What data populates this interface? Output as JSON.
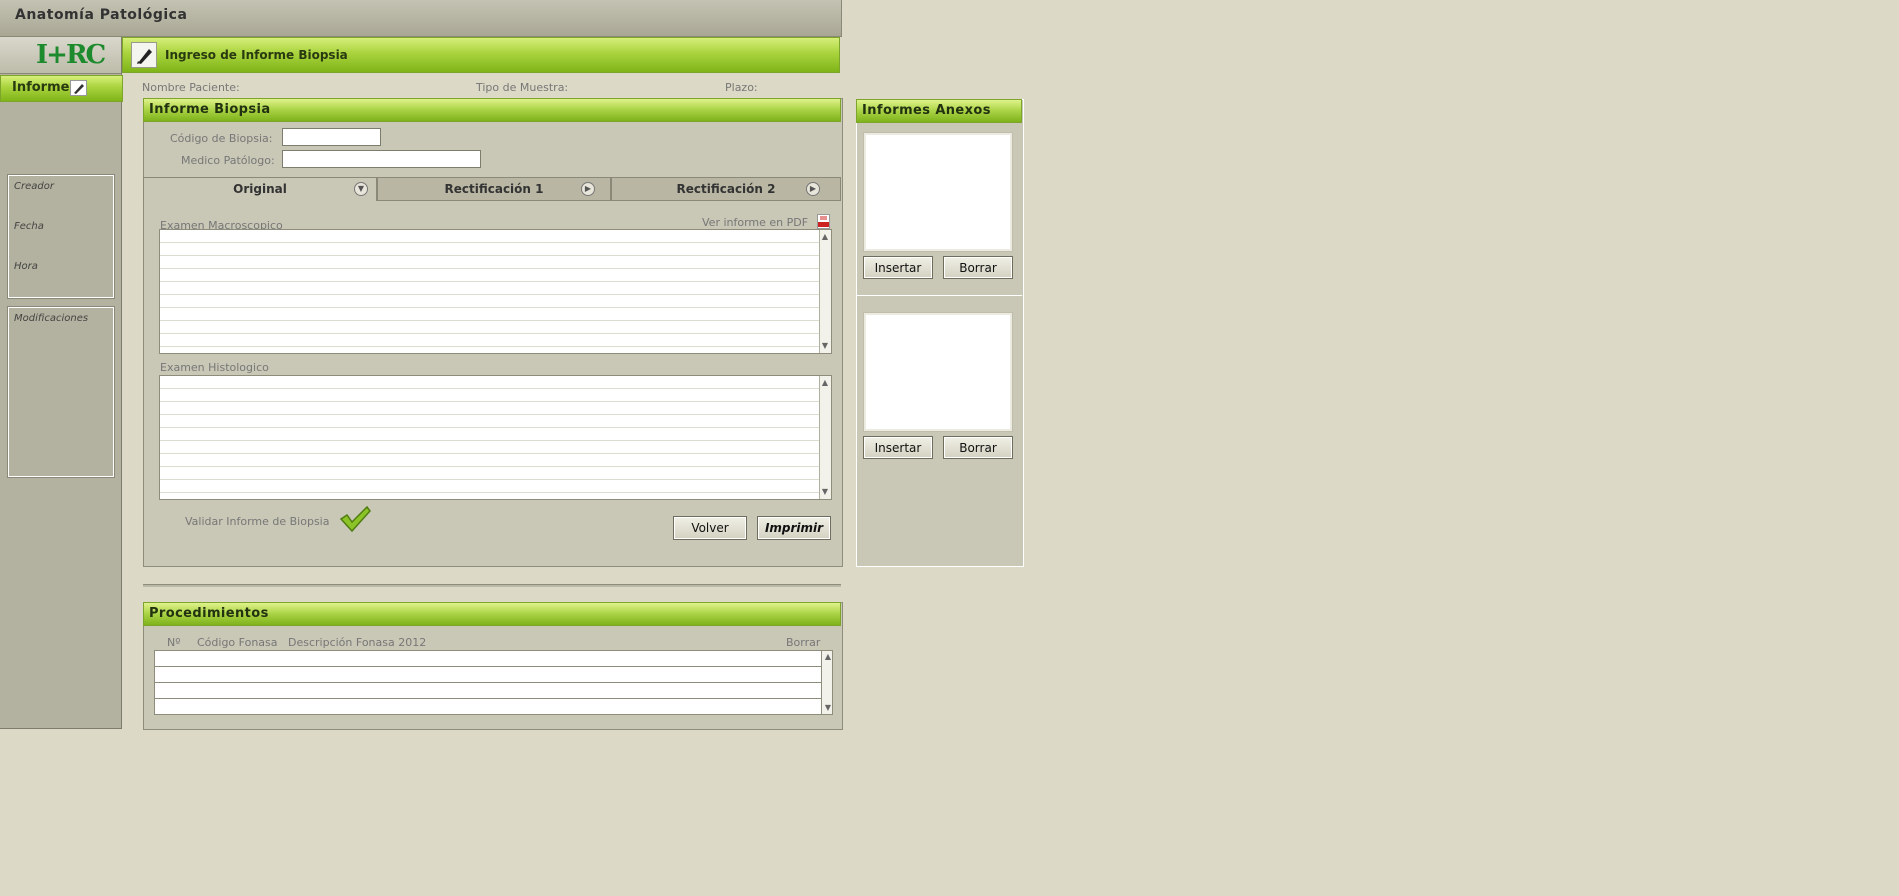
{
  "app": {
    "title": "Anatomía Patológica"
  },
  "logo": {
    "text": "I+RC"
  },
  "sidebar": {
    "tab_label": "Informe",
    "info": {
      "creator_label": "Creador",
      "date_label": "Fecha",
      "time_label": "Hora"
    },
    "modifications_label": "Modificaciones"
  },
  "header": {
    "title": "Ingreso de Informe Biopsia"
  },
  "patient": {
    "name_label": "Nombre Paciente:",
    "sample_type_label": "Tipo de Muestra:",
    "deadline_label": "Plazo:"
  },
  "report": {
    "title": "Informe Biopsia",
    "biopsy_code_label": "Código de Biopsia:",
    "biopsy_code_value": "",
    "pathologist_label": "Medico Patólogo:",
    "pathologist_value": "",
    "tabs": [
      "Original",
      "Rectificación 1",
      "Rectificación 2"
    ],
    "pdf_link": "Ver informe en PDF",
    "macro_label": "Examen Macroscopico",
    "histo_label": "Examen Histologico",
    "validate_label": "Validar Informe de Biopsia",
    "back_button": "Volver",
    "print_button": "Imprimir"
  },
  "annexes": {
    "title": "Informes Anexos",
    "insert_button": "Insertar",
    "delete_button": "Borrar"
  },
  "procedures": {
    "title": "Procedimientos",
    "columns": [
      "Nº",
      "Código Fonasa",
      "Descripción Fonasa 2012",
      "Borrar"
    ],
    "rows": [
      [],
      [],
      [],
      []
    ]
  },
  "colors": {
    "accent_green": "#a9d33d",
    "background": "#dcd9c6",
    "panel": "#c9c7b6"
  },
  "icons": [
    "edit-icon",
    "pdf-icon",
    "checkmark-icon",
    "chevron-down-icon",
    "chevron-right-icon"
  ]
}
